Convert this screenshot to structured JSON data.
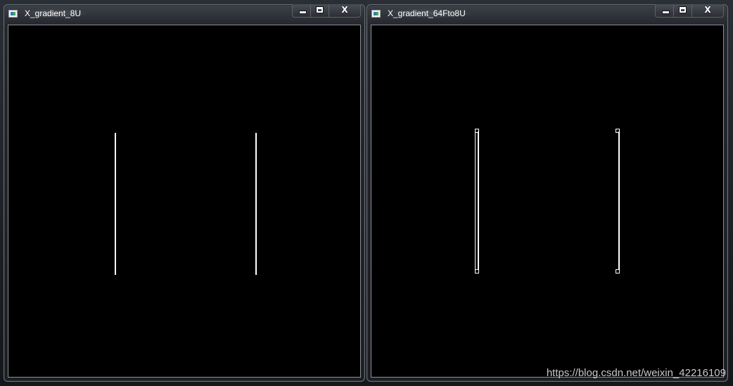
{
  "windows": [
    {
      "title": "X_gradient_8U",
      "buttons": {
        "minimize": "minimize",
        "maximize": "maximize",
        "close": "X"
      }
    },
    {
      "title": "X_gradient_64Fto8U",
      "buttons": {
        "minimize": "minimize",
        "maximize": "maximize",
        "close": "X"
      }
    }
  ],
  "watermark": "https://blog.csdn.net/weixin_42216109",
  "colors": {
    "canvas": "#000000",
    "edge": "#ffffff",
    "title_text": "#ffffff"
  },
  "icons": {
    "app": "image-window-icon",
    "minimize": "minimize-icon",
    "maximize": "maximize-icon",
    "close": "close-icon"
  }
}
